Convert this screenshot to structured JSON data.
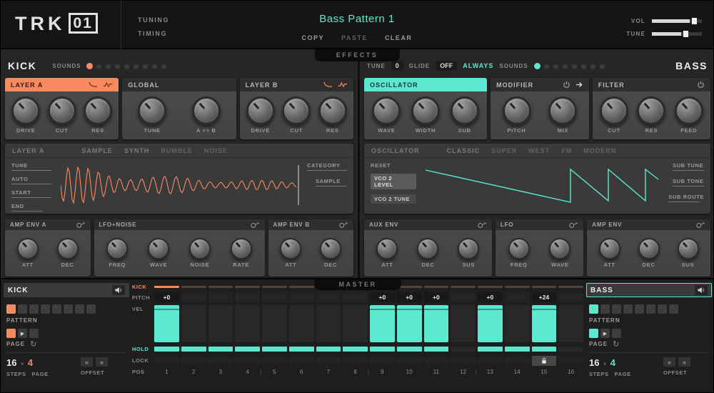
{
  "header": {
    "logo_trk": "TRK",
    "logo_num": "01",
    "tuning_label": "TUNING",
    "timing_label": "TIMING",
    "pattern_title": "Bass Pattern 1",
    "copy_label": "COPY",
    "paste_label": "PASTE",
    "clear_label": "CLEAR",
    "vol_label": "VOL",
    "tune_label": "TUNE",
    "vol_percent": 75,
    "tune_percent": 58
  },
  "effects_label": "EFFECTS",
  "master_label": "MASTER",
  "colors": {
    "orange": "#f98a5f",
    "teal": "#5ce8cf"
  },
  "kick": {
    "title": "KICK",
    "sounds_label": "SOUNDS",
    "sounds_total": 9,
    "sounds_active": 1,
    "panels": [
      {
        "title": "LAYER A",
        "knobs": [
          "DRIVE",
          "CUT",
          "RES"
        ]
      },
      {
        "title": "GLOBAL",
        "knobs": [
          "TUNE",
          "A <> B"
        ]
      },
      {
        "title": "LAYER B",
        "knobs": [
          "DRIVE",
          "CUT",
          "RES"
        ]
      }
    ],
    "sample": {
      "section_label": "LAYER A",
      "tabs": [
        "SAMPLE",
        "SYNTH",
        "RUMBLE",
        "NOISE"
      ],
      "active_tab": "SAMPLE",
      "left_params": [
        "TUNE",
        "AUTO",
        "START",
        "END"
      ],
      "right_params": [
        "CATEGORY",
        "SAMPLE"
      ]
    },
    "env_panels": [
      {
        "title": "AMP ENV A",
        "knobs": [
          "ATT",
          "DEC"
        ]
      },
      {
        "title": "LFO+NOISE",
        "knobs": [
          "FREQ",
          "WAVE",
          "NOISE",
          "RATE"
        ]
      },
      {
        "title": "AMP ENV B",
        "knobs": [
          "ATT",
          "DEC"
        ]
      }
    ]
  },
  "bass": {
    "title": "BASS",
    "tune_label": "TUNE",
    "tune_value": "0",
    "glide_label": "GLIDE",
    "glide_value": "OFF",
    "always_label": "ALWAYS",
    "sounds_label": "SOUNDS",
    "sounds_total": 8,
    "sounds_active": 1,
    "panels": [
      {
        "title": "OSCILLATOR",
        "knobs": [
          "WAVE",
          "WIDTH",
          "SUB"
        ]
      },
      {
        "title": "MODIFIER",
        "knobs": [
          "PITCH",
          "MIX"
        ]
      },
      {
        "title": "FILTER",
        "knobs": [
          "CUT",
          "RES",
          "FEED"
        ]
      }
    ],
    "osc": {
      "section_label": "OSCILLATOR",
      "tabs": [
        "CLASSIC",
        "SUPER",
        "WEST",
        "FM",
        "MODERN"
      ],
      "active_tab": "CLASSIC",
      "left_params": [
        "RESET",
        "VCO 2 LEVEL",
        "VCO 2 TUNE"
      ],
      "right_params": [
        "SUB TUNE",
        "SUB TONE",
        "SUB ROUTE"
      ]
    },
    "env_panels": [
      {
        "title": "AUX ENV",
        "knobs": [
          "ATT",
          "DEC",
          "SUS"
        ]
      },
      {
        "title": "LFO",
        "knobs": [
          "FREQ",
          "WAVE"
        ]
      },
      {
        "title": "AMP ENV",
        "knobs": [
          "ATT",
          "DEC",
          "SUS"
        ]
      }
    ]
  },
  "channel_kick": {
    "title": "KICK",
    "pattern_label": "PATTERN",
    "page_label": "PAGE",
    "steps_value": "16",
    "multiply_sign": "×",
    "pages_value": "4",
    "steps_label": "STEPS",
    "page_label2": "PAGE",
    "offset_label": "OFFSET",
    "prev_label": "«",
    "next_label": "»",
    "play_glyph": "▶",
    "pattern_cells": 8,
    "active_cell": 1
  },
  "channel_bass": {
    "title": "BASS",
    "pattern_label": "PATTERN",
    "page_label": "PAGE",
    "steps_value": "16",
    "multiply_sign": "×",
    "pages_value": "4",
    "steps_label": "STEPS",
    "page_label2": "PAGE",
    "offset_label": "OFFSET",
    "prev_label": "«",
    "next_label": "»",
    "play_glyph": "▶",
    "pattern_cells": 8,
    "active_cell": 1
  },
  "sequencer": {
    "row_labels": {
      "kick": "KICK",
      "pitch": "PITCH",
      "vel": "VEL",
      "hold": "HOLD",
      "lock": "LOCK",
      "pos": "POS"
    },
    "steps": [
      {
        "pos": "1",
        "pitch": "+0",
        "vel": true,
        "hold": true,
        "lock": false,
        "kick": true
      },
      {
        "pos": "2",
        "pitch": "",
        "vel": false,
        "hold": true,
        "lock": false,
        "kick": false
      },
      {
        "pos": "3",
        "pitch": "",
        "vel": false,
        "hold": true,
        "lock": false,
        "kick": false
      },
      {
        "pos": "4",
        "pitch": "",
        "vel": false,
        "hold": true,
        "lock": false,
        "kick": false
      },
      {
        "pos": "5",
        "pitch": "",
        "vel": false,
        "hold": true,
        "lock": false,
        "kick": false
      },
      {
        "pos": "6",
        "pitch": "",
        "vel": false,
        "hold": true,
        "lock": false,
        "kick": false
      },
      {
        "pos": "7",
        "pitch": "",
        "vel": false,
        "hold": true,
        "lock": false,
        "kick": false
      },
      {
        "pos": "8",
        "pitch": "",
        "vel": false,
        "hold": true,
        "lock": false,
        "kick": false
      },
      {
        "pos": "9",
        "pitch": "+0",
        "vel": true,
        "hold": true,
        "lock": false,
        "kick": false
      },
      {
        "pos": "10",
        "pitch": "+0",
        "vel": true,
        "hold": true,
        "lock": false,
        "kick": false
      },
      {
        "pos": "11",
        "pitch": "+0",
        "vel": true,
        "hold": true,
        "lock": false,
        "kick": false
      },
      {
        "pos": "12",
        "pitch": "",
        "vel": false,
        "hold": false,
        "lock": false,
        "kick": false
      },
      {
        "pos": "13",
        "pitch": "+0",
        "vel": true,
        "hold": true,
        "lock": false,
        "kick": false
      },
      {
        "pos": "14",
        "pitch": "",
        "vel": false,
        "hold": true,
        "lock": false,
        "kick": false
      },
      {
        "pos": "15",
        "pitch": "+24",
        "vel": true,
        "hold": true,
        "lock": true,
        "kick": false
      },
      {
        "pos": "16",
        "pitch": "",
        "vel": false,
        "hold": false,
        "lock": false,
        "kick": false
      }
    ]
  }
}
